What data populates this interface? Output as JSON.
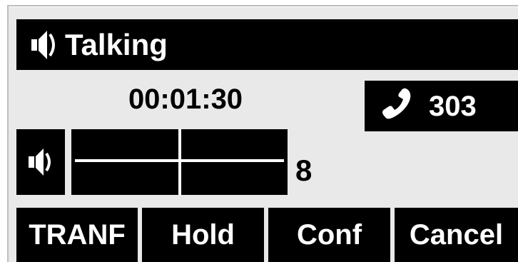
{
  "status": {
    "icon": "speaker-icon",
    "text": "Talking"
  },
  "call": {
    "timer": "00:01:30",
    "icon": "handset-icon",
    "number": "303"
  },
  "volume": {
    "icon": "speaker-icon",
    "level": "8"
  },
  "softkeys": [
    {
      "label": "TRANF"
    },
    {
      "label": "Hold"
    },
    {
      "label": "Conf"
    },
    {
      "label": "Cancel"
    }
  ],
  "colors": {
    "background": "#e9e9e9",
    "bar": "#000000",
    "text_inverse": "#ffffff",
    "text": "#000000"
  }
}
